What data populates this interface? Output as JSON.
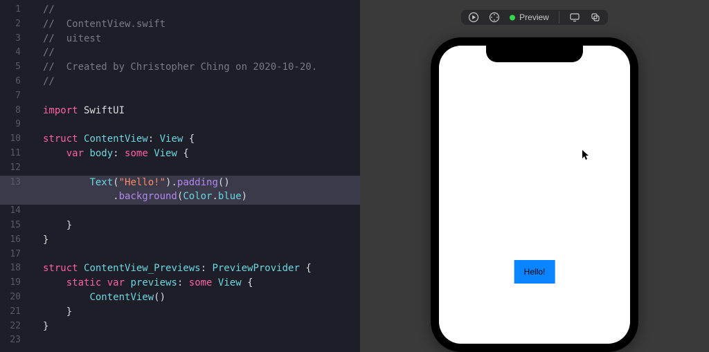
{
  "editor": {
    "highlighted_line": 13,
    "lines": [
      {
        "n": 1,
        "segments": [
          {
            "cls": "tok-comment",
            "t": "//"
          }
        ]
      },
      {
        "n": 2,
        "segments": [
          {
            "cls": "tok-comment",
            "t": "//  ContentView.swift"
          }
        ]
      },
      {
        "n": 3,
        "segments": [
          {
            "cls": "tok-comment",
            "t": "//  uitest"
          }
        ]
      },
      {
        "n": 4,
        "segments": [
          {
            "cls": "tok-comment",
            "t": "//"
          }
        ]
      },
      {
        "n": 5,
        "segments": [
          {
            "cls": "tok-comment",
            "t": "//  Created by Christopher Ching on 2020-10-20."
          }
        ]
      },
      {
        "n": 6,
        "segments": [
          {
            "cls": "tok-comment",
            "t": "//"
          }
        ]
      },
      {
        "n": 7,
        "segments": [
          {
            "cls": "tok-ident",
            "t": ""
          }
        ]
      },
      {
        "n": 8,
        "segments": [
          {
            "cls": "tok-keyword",
            "t": "import"
          },
          {
            "cls": "tok-ident",
            "t": " SwiftUI"
          }
        ]
      },
      {
        "n": 9,
        "segments": [
          {
            "cls": "tok-ident",
            "t": ""
          }
        ]
      },
      {
        "n": 10,
        "segments": [
          {
            "cls": "tok-keyword",
            "t": "struct"
          },
          {
            "cls": "tok-ident",
            "t": " "
          },
          {
            "cls": "tok-type",
            "t": "ContentView"
          },
          {
            "cls": "tok-ident",
            "t": ": "
          },
          {
            "cls": "tok-type",
            "t": "View"
          },
          {
            "cls": "tok-ident",
            "t": " {"
          }
        ]
      },
      {
        "n": 11,
        "segments": [
          {
            "cls": "tok-ident",
            "t": "    "
          },
          {
            "cls": "tok-keyword",
            "t": "var"
          },
          {
            "cls": "tok-ident",
            "t": " "
          },
          {
            "cls": "tok-prop",
            "t": "body"
          },
          {
            "cls": "tok-ident",
            "t": ": "
          },
          {
            "cls": "tok-keyword",
            "t": "some"
          },
          {
            "cls": "tok-ident",
            "t": " "
          },
          {
            "cls": "tok-type",
            "t": "View"
          },
          {
            "cls": "tok-ident",
            "t": " {"
          }
        ]
      },
      {
        "n": 12,
        "segments": [
          {
            "cls": "tok-ident",
            "t": ""
          }
        ]
      },
      {
        "n": 13,
        "segments": [
          {
            "cls": "tok-ident",
            "t": "        "
          },
          {
            "cls": "tok-type",
            "t": "Text"
          },
          {
            "cls": "tok-ident",
            "t": "("
          },
          {
            "cls": "tok-string",
            "t": "\"Hello!\""
          },
          {
            "cls": "tok-ident",
            "t": ")."
          },
          {
            "cls": "tok-func",
            "t": "padding"
          },
          {
            "cls": "tok-ident",
            "t": "()"
          }
        ]
      },
      {
        "n": 13.5,
        "continuation": true,
        "segments": [
          {
            "cls": "tok-ident",
            "t": "            ."
          },
          {
            "cls": "tok-func",
            "t": "background"
          },
          {
            "cls": "tok-ident",
            "t": "("
          },
          {
            "cls": "tok-type",
            "t": "Color"
          },
          {
            "cls": "tok-ident",
            "t": "."
          },
          {
            "cls": "tok-prop",
            "t": "blue"
          },
          {
            "cls": "tok-ident",
            "t": ")"
          }
        ]
      },
      {
        "n": 14,
        "segments": [
          {
            "cls": "tok-ident",
            "t": ""
          }
        ]
      },
      {
        "n": 15,
        "segments": [
          {
            "cls": "tok-ident",
            "t": "    }"
          }
        ]
      },
      {
        "n": 16,
        "segments": [
          {
            "cls": "tok-ident",
            "t": "}"
          }
        ]
      },
      {
        "n": 17,
        "segments": [
          {
            "cls": "tok-ident",
            "t": ""
          }
        ]
      },
      {
        "n": 18,
        "segments": [
          {
            "cls": "tok-keyword",
            "t": "struct"
          },
          {
            "cls": "tok-ident",
            "t": " "
          },
          {
            "cls": "tok-type",
            "t": "ContentView_Previews"
          },
          {
            "cls": "tok-ident",
            "t": ": "
          },
          {
            "cls": "tok-type",
            "t": "PreviewProvider"
          },
          {
            "cls": "tok-ident",
            "t": " {"
          }
        ]
      },
      {
        "n": 19,
        "segments": [
          {
            "cls": "tok-ident",
            "t": "    "
          },
          {
            "cls": "tok-keyword",
            "t": "static"
          },
          {
            "cls": "tok-ident",
            "t": " "
          },
          {
            "cls": "tok-keyword",
            "t": "var"
          },
          {
            "cls": "tok-ident",
            "t": " "
          },
          {
            "cls": "tok-prop",
            "t": "previews"
          },
          {
            "cls": "tok-ident",
            "t": ": "
          },
          {
            "cls": "tok-keyword",
            "t": "some"
          },
          {
            "cls": "tok-ident",
            "t": " "
          },
          {
            "cls": "tok-type",
            "t": "View"
          },
          {
            "cls": "tok-ident",
            "t": " {"
          }
        ]
      },
      {
        "n": 20,
        "segments": [
          {
            "cls": "tok-ident",
            "t": "        "
          },
          {
            "cls": "tok-type",
            "t": "ContentView"
          },
          {
            "cls": "tok-ident",
            "t": "()"
          }
        ]
      },
      {
        "n": 21,
        "segments": [
          {
            "cls": "tok-ident",
            "t": "    }"
          }
        ]
      },
      {
        "n": 22,
        "segments": [
          {
            "cls": "tok-ident",
            "t": "}"
          }
        ]
      },
      {
        "n": 23,
        "segments": [
          {
            "cls": "tok-ident",
            "t": ""
          }
        ]
      }
    ]
  },
  "toolbar": {
    "preview_label": "Preview",
    "status_color": "#32d74b"
  },
  "sim": {
    "hello_text": "Hello!",
    "hello_bg": "#0a84ff"
  }
}
